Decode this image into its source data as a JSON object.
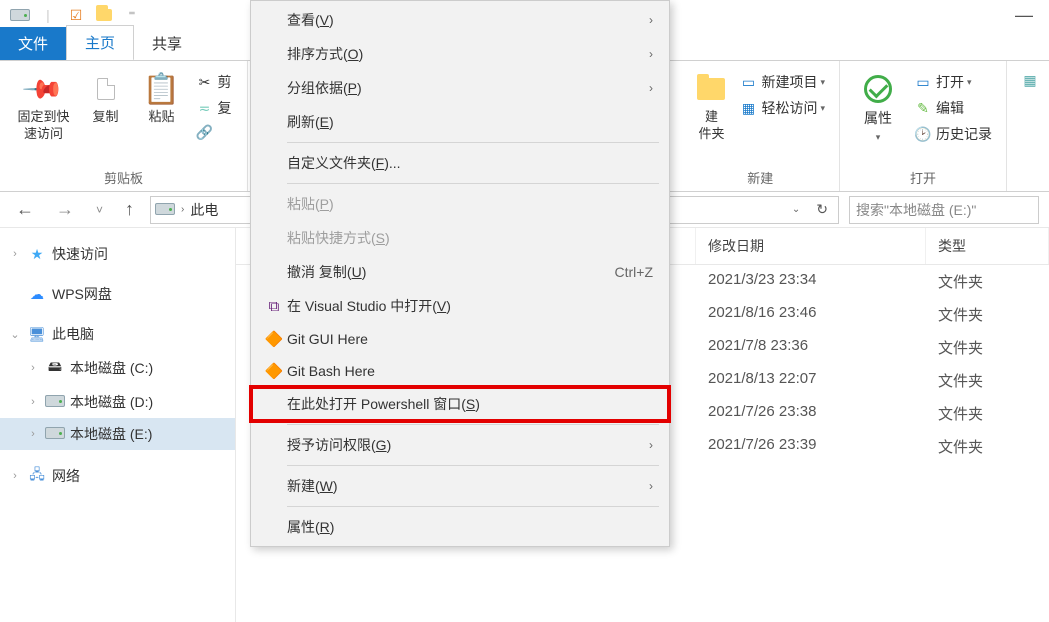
{
  "tabs": {
    "file": "文件",
    "home": "主页",
    "share": "共享"
  },
  "ribbon": {
    "clipboard": {
      "pin": "固定到快\n速访问",
      "copy": "复制",
      "paste": "粘贴",
      "cut": "剪",
      "cp": "复",
      "group": "剪贴板"
    },
    "new": {
      "folder2": "建\n件夹",
      "newitem": "新建项目",
      "easy": "轻松访问",
      "group": "新建"
    },
    "open": {
      "props": "属性",
      "open": "打开",
      "edit": "编辑",
      "history": "历史记录",
      "group": "打开"
    }
  },
  "address": {
    "loc": "此电",
    "search": "搜索\"本地磁盘 (E:)\""
  },
  "tree": {
    "quick": "快速访问",
    "wps": "WPS网盘",
    "pc": "此电脑",
    "c": "本地磁盘 (C:)",
    "d": "本地磁盘 (D:)",
    "e": "本地磁盘 (E:)",
    "net": "网络"
  },
  "cols": {
    "date": "修改日期",
    "type": "类型"
  },
  "rows": [
    {
      "date": "2021/3/23 23:34",
      "type": "文件夹"
    },
    {
      "date": "2021/8/16 23:46",
      "type": "文件夹"
    },
    {
      "date": "2021/7/8 23:36",
      "type": "文件夹"
    },
    {
      "date": "2021/8/13 22:07",
      "type": "文件夹"
    },
    {
      "date": "2021/7/26 23:38",
      "type": "文件夹"
    },
    {
      "date": "2021/7/26 23:39",
      "type": "文件夹"
    }
  ],
  "ctx": {
    "view": "查看(",
    "viewK": "V",
    "sort": "排序方式(",
    "sortK": "O",
    "group": "分组依据(",
    "groupK": "P",
    "refresh": "刷新(",
    "refreshK": "E",
    "custom": "自定义文件夹(",
    "customK": "F",
    "customTail": ")...",
    "paste": "粘贴(",
    "pasteK": "P",
    "pasteSc": "粘贴快捷方式(",
    "pasteScK": "S",
    "undo": "撤消 复制(",
    "undoK": "U",
    "undoSc": "Ctrl+Z",
    "vs": "在 Visual Studio 中打开(",
    "vsK": "V",
    "gitgui": "Git GUI Here",
    "gitbash": "Git Bash Here",
    "ps": "在此处打开 Powershell 窗口(",
    "psK": "S",
    "access": "授予访问权限(",
    "accessK": "G",
    "new": "新建(",
    "newK": "W",
    "props": "属性(",
    "propsK": "R",
    "close": ")"
  }
}
